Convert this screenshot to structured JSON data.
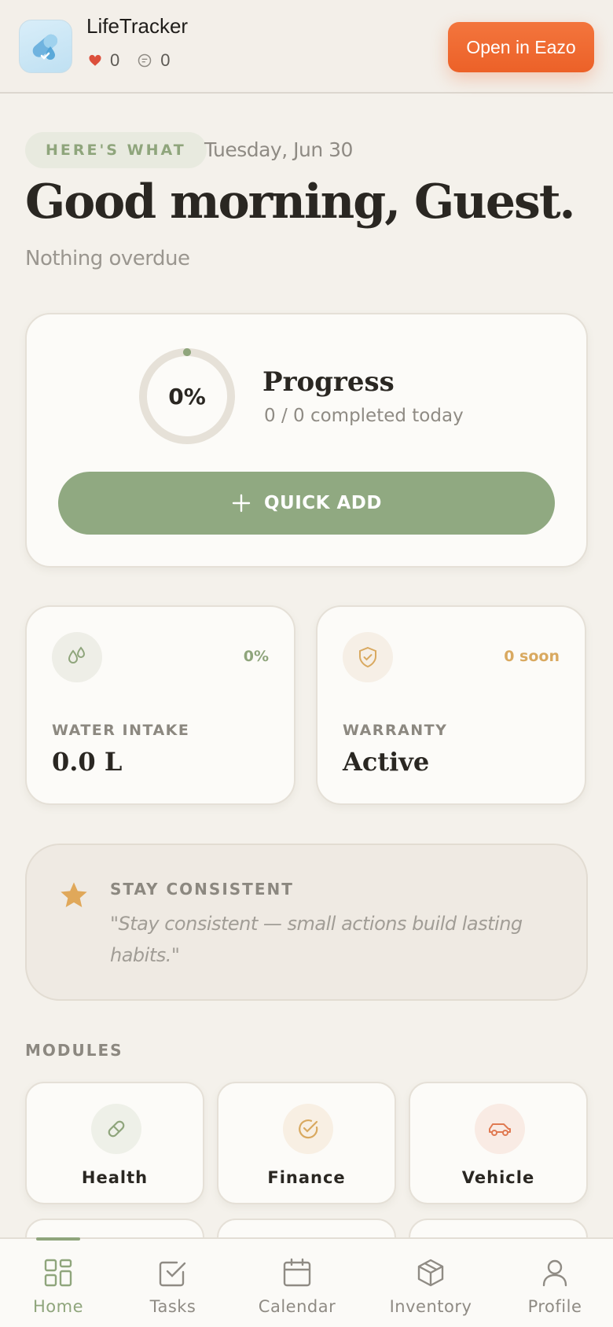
{
  "header": {
    "app_name": "LifeTracker",
    "likes": "0",
    "comments": "0",
    "open_button": "Open in Eazo",
    "accent": "#ec6128"
  },
  "greeting": {
    "eyebrow": "HERE'S WHAT",
    "date": "Tuesday, Jun 30",
    "title": "Good morning, Guest.",
    "subtitle": "Nothing overdue"
  },
  "progress": {
    "percent_label": "0%",
    "percent": 0,
    "title": "Progress",
    "subtitle": "0 / 0 completed today",
    "quick_add": "QUICK ADD",
    "accent": "#90a981"
  },
  "stats": {
    "water": {
      "icon": "droplets-icon",
      "badge": "0%",
      "label": "WATER INTAKE",
      "value": "0.0 L"
    },
    "warranty": {
      "icon": "shield-check-icon",
      "badge": "0 soon",
      "label": "WARRANTY",
      "value": "Active"
    }
  },
  "quote": {
    "icon": "star-icon",
    "title": "STAY CONSISTENT",
    "text": "\"Stay consistent — small actions build lasting habits.\""
  },
  "modules": {
    "title": "MODULES",
    "items": [
      {
        "label": "Health",
        "icon": "pill-icon"
      },
      {
        "label": "Finance",
        "icon": "check-circle-icon"
      },
      {
        "label": "Vehicle",
        "icon": "car-icon"
      }
    ]
  },
  "nav": {
    "items": [
      {
        "label": "Home",
        "icon": "home-grid-icon",
        "active": true
      },
      {
        "label": "Tasks",
        "icon": "checkbox-icon"
      },
      {
        "label": "Calendar",
        "icon": "calendar-icon"
      },
      {
        "label": "Inventory",
        "icon": "box-icon"
      },
      {
        "label": "Profile",
        "icon": "user-icon"
      }
    ]
  }
}
